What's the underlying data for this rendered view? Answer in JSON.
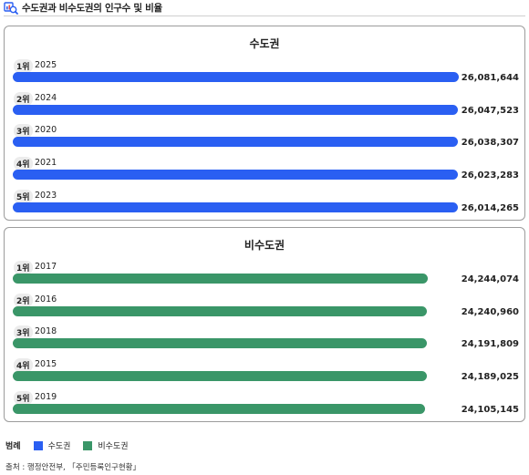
{
  "header": {
    "title": "수도권과 비수도권의 인구수 및 비율"
  },
  "chart_data": [
    {
      "type": "bar",
      "title": "수도권",
      "color": "#2a5ff2",
      "rows": [
        {
          "rank": "1위",
          "year": "2025",
          "value": 26081644,
          "label": "26,081,644"
        },
        {
          "rank": "2위",
          "year": "2024",
          "value": 26047523,
          "label": "26,047,523"
        },
        {
          "rank": "3위",
          "year": "2020",
          "value": 26038307,
          "label": "26,038,307"
        },
        {
          "rank": "4위",
          "year": "2021",
          "value": 26023283,
          "label": "26,023,283"
        },
        {
          "rank": "5위",
          "year": "2023",
          "value": 26014265,
          "label": "26,014,265"
        }
      ]
    },
    {
      "type": "bar",
      "title": "비수도권",
      "color": "#3a9668",
      "rows": [
        {
          "rank": "1위",
          "year": "2017",
          "value": 24244074,
          "label": "24,244,074"
        },
        {
          "rank": "2위",
          "year": "2016",
          "value": 24240960,
          "label": "24,240,960"
        },
        {
          "rank": "3위",
          "year": "2018",
          "value": 24191809,
          "label": "24,191,809"
        },
        {
          "rank": "4위",
          "year": "2015",
          "value": 24189025,
          "label": "24,189,025"
        },
        {
          "rank": "5위",
          "year": "2019",
          "value": 24105145,
          "label": "24,105,145"
        }
      ]
    }
  ],
  "legend": {
    "title": "범례",
    "items": [
      {
        "label": "수도권",
        "color": "#2a5ff2"
      },
      {
        "label": "비수도권",
        "color": "#3a9668"
      }
    ]
  },
  "source": "출처 : 행정안전부, 「주민등록인구현황」"
}
